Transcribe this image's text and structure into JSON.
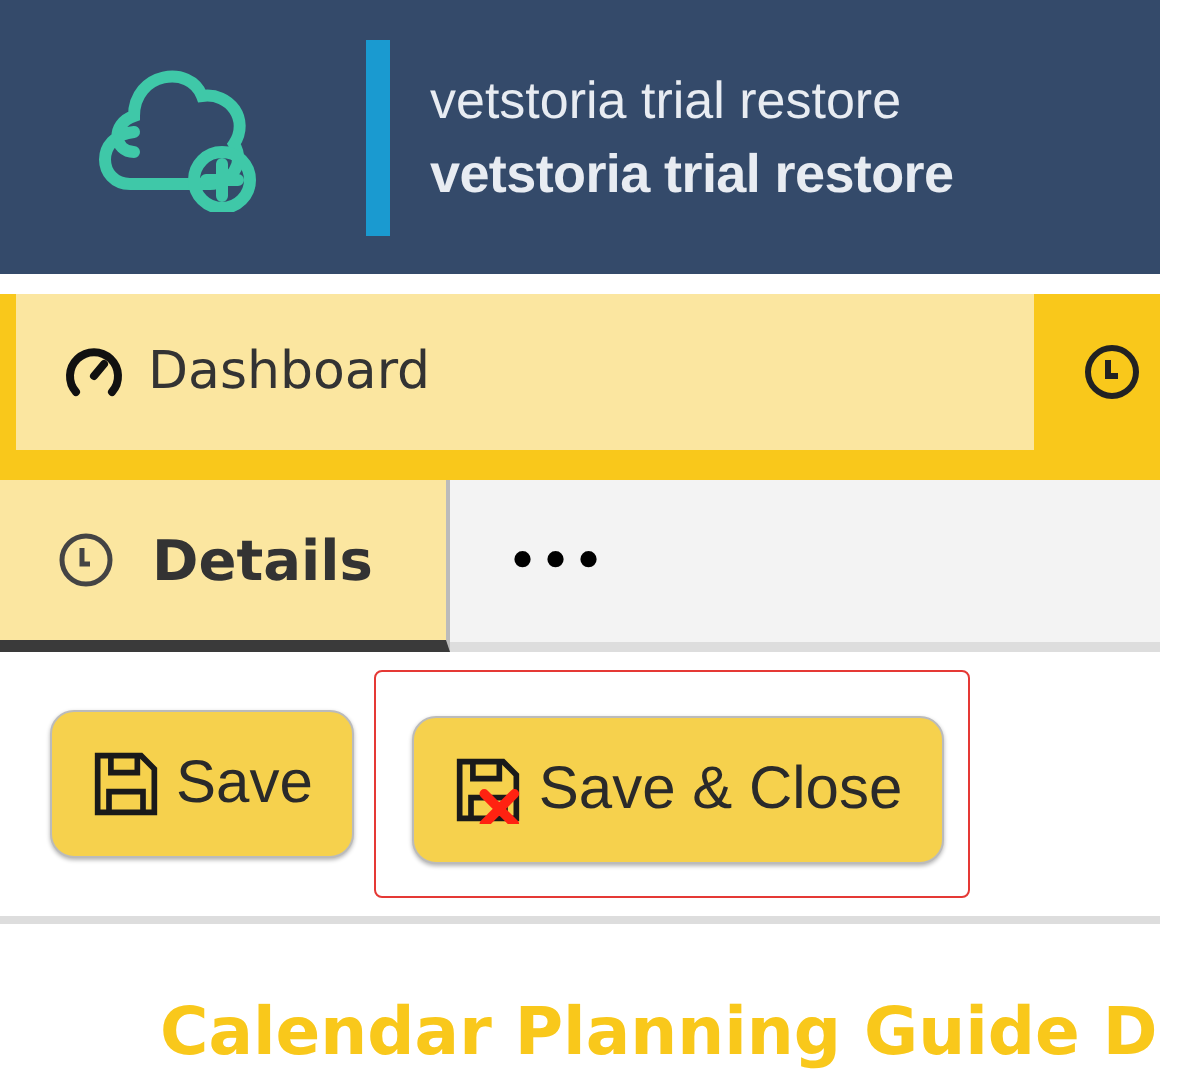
{
  "header": {
    "title": "vetstoria trial restore",
    "subtitle": "vetstoria trial restore"
  },
  "tabs": [
    {
      "label": "Dashboard",
      "selected": false,
      "kind": "gauge"
    },
    {
      "selected": true,
      "kind": "clock"
    }
  ],
  "subtabs": [
    {
      "label": "Details",
      "selected": true,
      "kind": "clock"
    },
    {
      "label": "•••",
      "selected": false
    }
  ],
  "toolbar": [
    {
      "label": "Save",
      "kind": "save"
    },
    {
      "label": "Save & Close",
      "kind": "save-close",
      "highlighted": true
    }
  ],
  "page_title": "Calendar Planning Guide D"
}
